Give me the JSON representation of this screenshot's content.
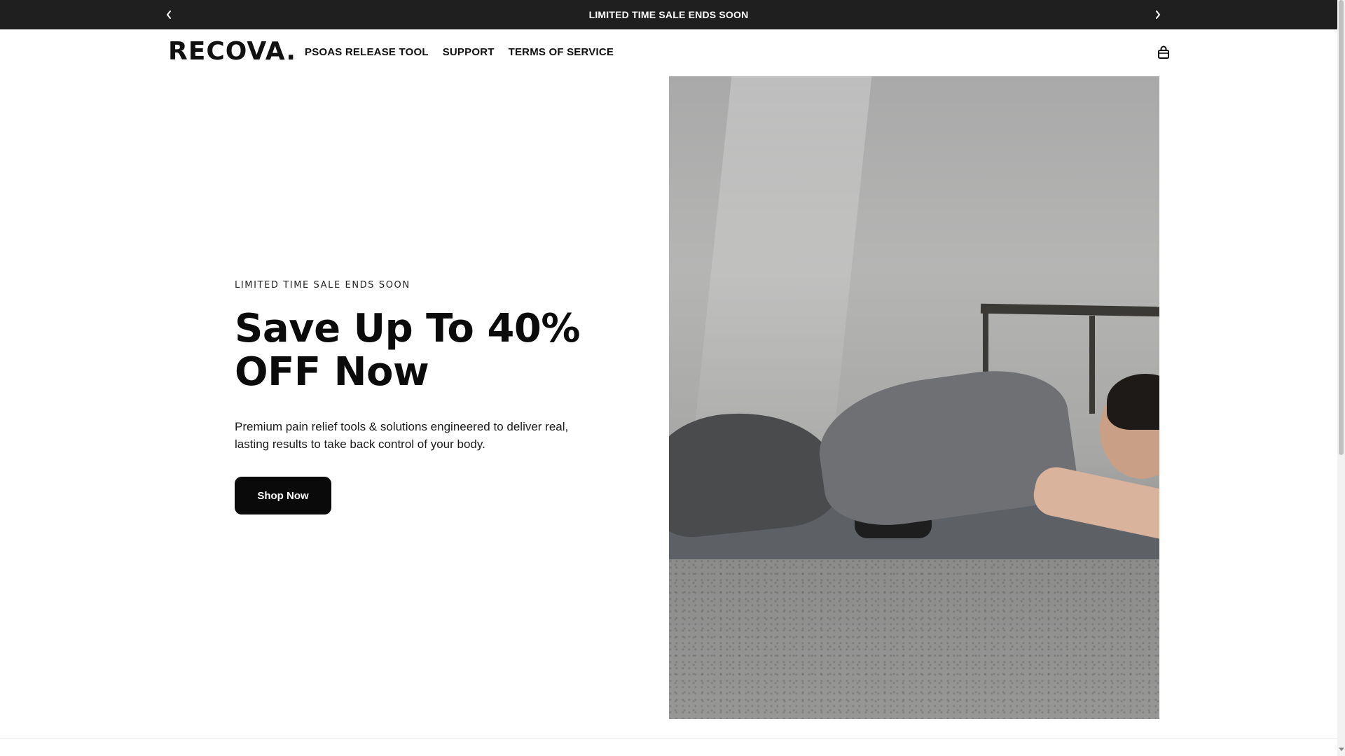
{
  "announcement": {
    "text": "LIMITED TIME SALE ENDS SOON",
    "prev_icon": "chevron-left-icon",
    "next_icon": "chevron-right-icon"
  },
  "header": {
    "logo": "RECOVA.",
    "nav": [
      {
        "label": "PSOAS RELEASE TOOL"
      },
      {
        "label": "SUPPORT"
      },
      {
        "label": "TERMS OF SERVICE"
      }
    ],
    "cart_icon": "shopping-bag-icon"
  },
  "hero": {
    "eyebrow": "LIMITED TIME SALE ENDS SOON",
    "headline_line1": "Save Up To 40%",
    "headline_line2": "OFF Now",
    "subtext": "Premium pain relief tools & solutions engineered to deliver real, lasting results to take back control of your body.",
    "button_label": "Shop Now",
    "image_alt": "man lying on psoas release tool on gym mat"
  },
  "colors": {
    "announcement_bg": "#1f1f1f",
    "button_bg": "#0a0a0a",
    "text": "#111111",
    "background": "#ffffff"
  }
}
